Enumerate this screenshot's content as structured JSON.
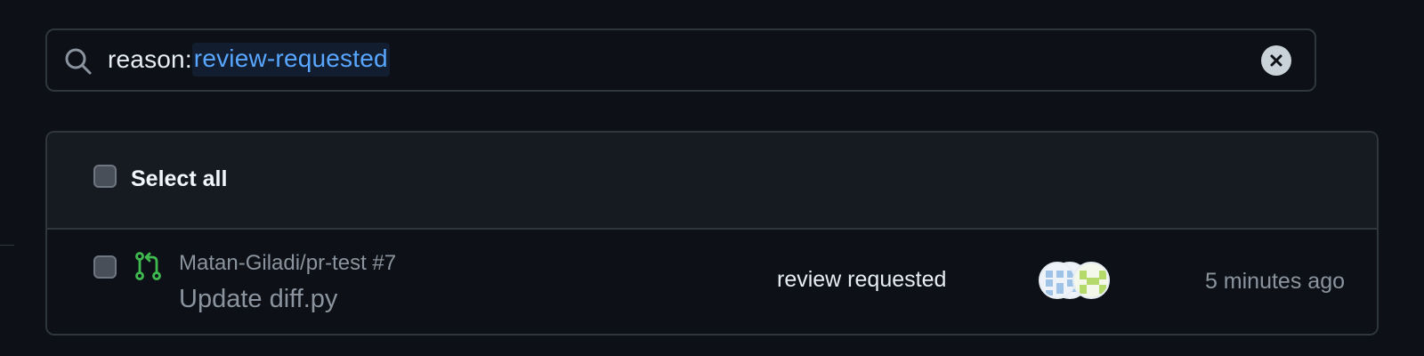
{
  "search": {
    "query_key": "reason:",
    "query_value": "review-requested",
    "icon": "search-icon",
    "clear_icon": "clear-icon"
  },
  "list": {
    "select_all_label": "Select all",
    "rows": [
      {
        "repo": "Matan-Giladi/pr-test #7",
        "title": "Update diff.py",
        "icon": "pull-request-icon",
        "icon_color": "#3fb950",
        "reason": "review requested",
        "time": "5 minutes ago",
        "avatars": [
          "avatar",
          "avatar",
          "avatar"
        ]
      }
    ]
  },
  "colors": {
    "background": "#0d1117",
    "header_background": "#161b22",
    "border": "#30363d",
    "accent": "#58a6ff",
    "muted_text": "#8b949e"
  }
}
